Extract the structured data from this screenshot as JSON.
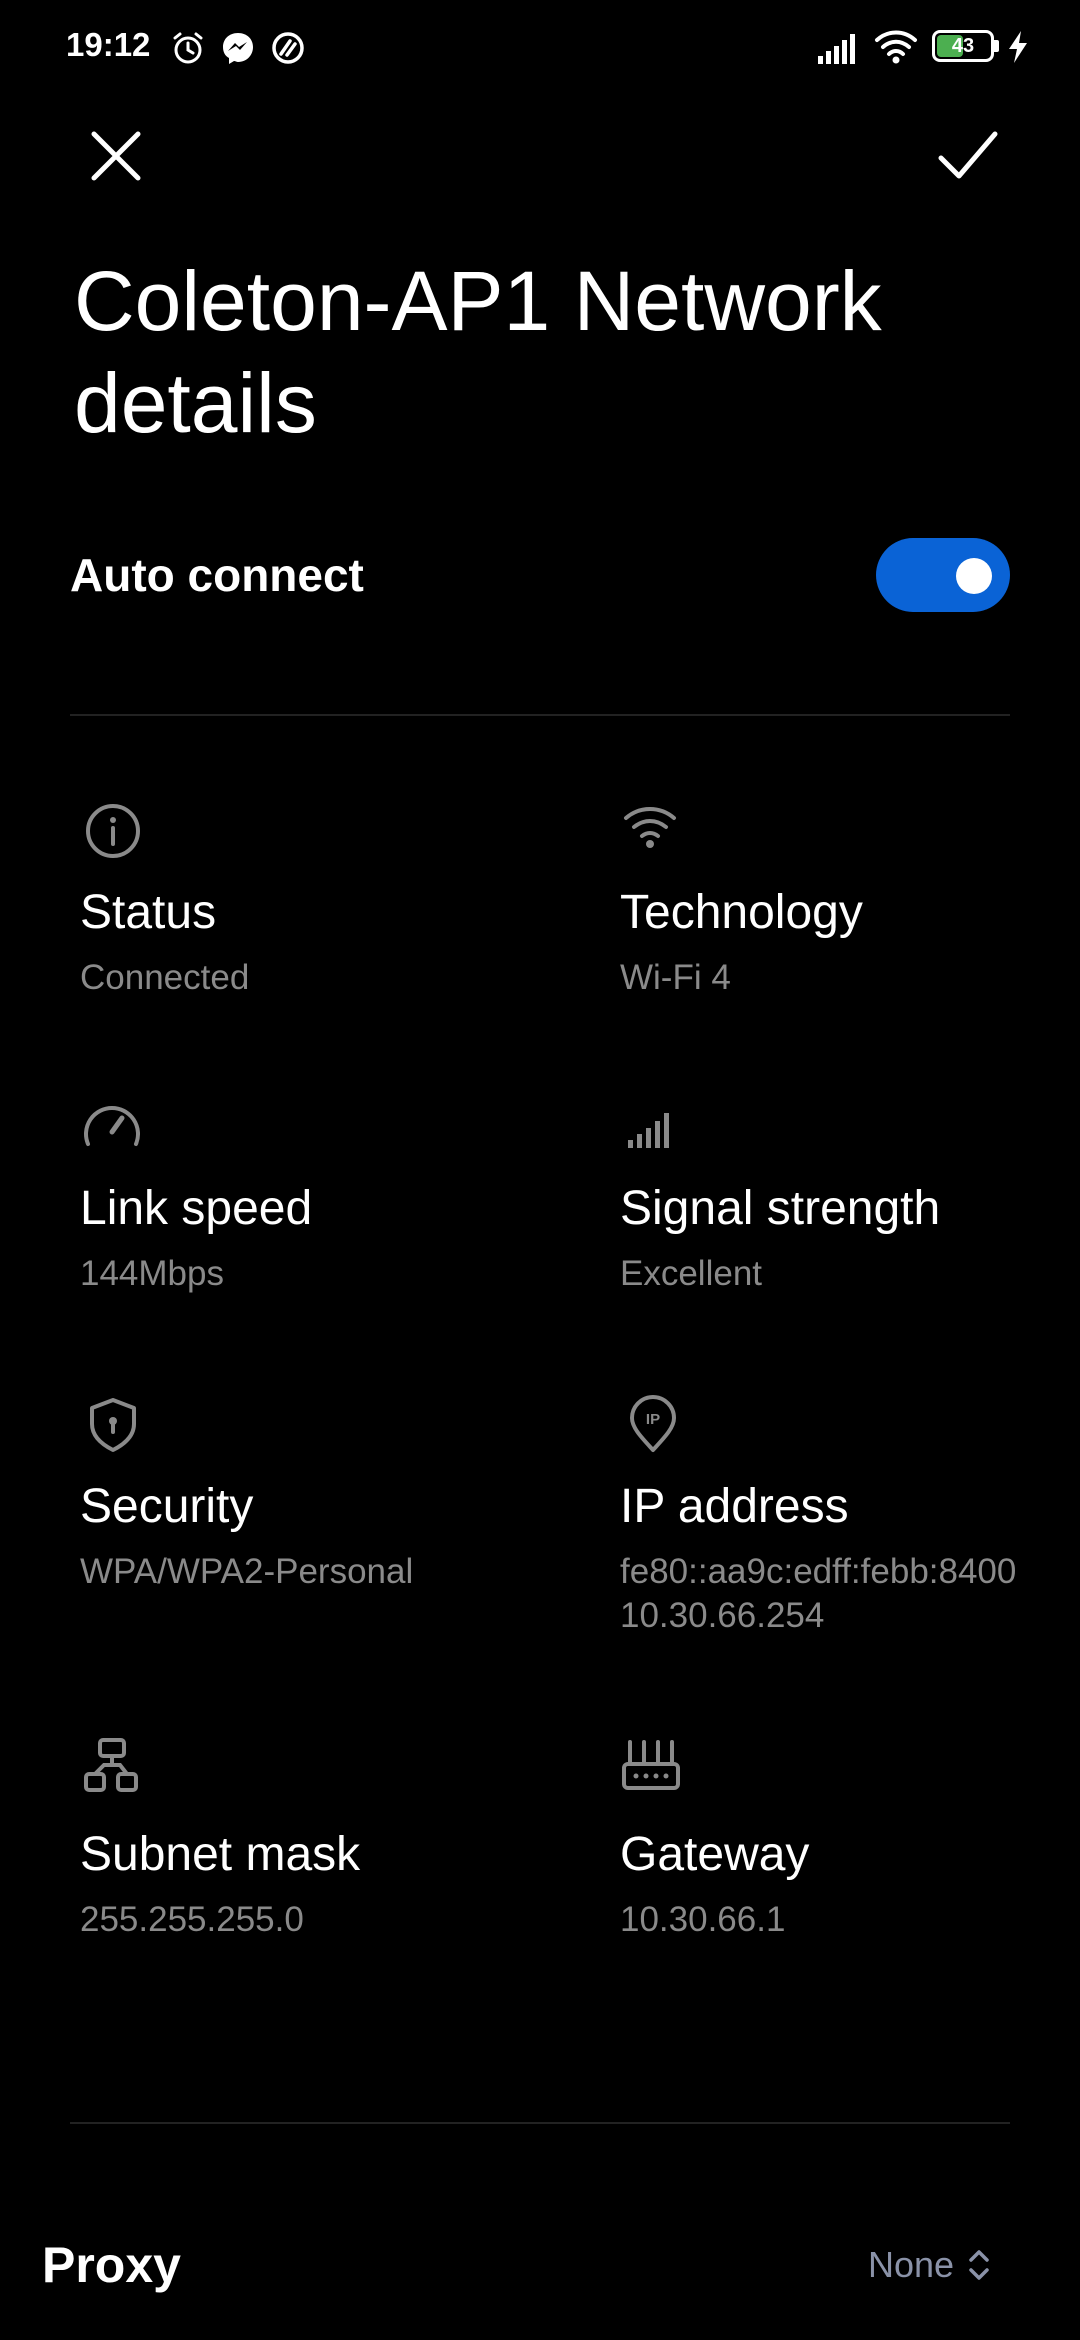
{
  "status_bar": {
    "time": "19:12",
    "left_icons": [
      "alarm-icon",
      "messenger-icon",
      "sync-icon"
    ],
    "battery_level": "43",
    "battery_color": "#4caf50",
    "right_icons": [
      "cellular-signal-icon",
      "wifi-icon",
      "battery-icon",
      "charging-icon"
    ]
  },
  "header": {
    "close_icon": "close-icon",
    "confirm_icon": "check-icon",
    "title": "Coleton-AP1 Network details"
  },
  "auto_connect": {
    "label": "Auto connect",
    "enabled": true,
    "accent": "#0a63d6"
  },
  "details": [
    {
      "icon": "info-icon",
      "title": "Status",
      "value": "Connected"
    },
    {
      "icon": "wifi-icon",
      "title": "Technology",
      "value": "Wi-Fi 4"
    },
    {
      "icon": "speedometer-icon",
      "title": "Link speed",
      "value": "144Mbps"
    },
    {
      "icon": "signal-strength-icon",
      "title": "Signal strength",
      "value": "Excellent"
    },
    {
      "icon": "shield-icon",
      "title": "Security",
      "value": "WPA/WPA2-Personal"
    },
    {
      "icon": "ip-location-icon",
      "title": "IP address",
      "value": "fe80::aa9c:edff:febb:8400",
      "value2": "10.30.66.254"
    },
    {
      "icon": "network-topology-icon",
      "title": "Subnet mask",
      "value": "255.255.255.0"
    },
    {
      "icon": "router-icon",
      "title": "Gateway",
      "value": "10.30.66.1"
    }
  ],
  "proxy": {
    "label": "Proxy",
    "value": "None",
    "icon": "chevron-up-down-icon"
  }
}
